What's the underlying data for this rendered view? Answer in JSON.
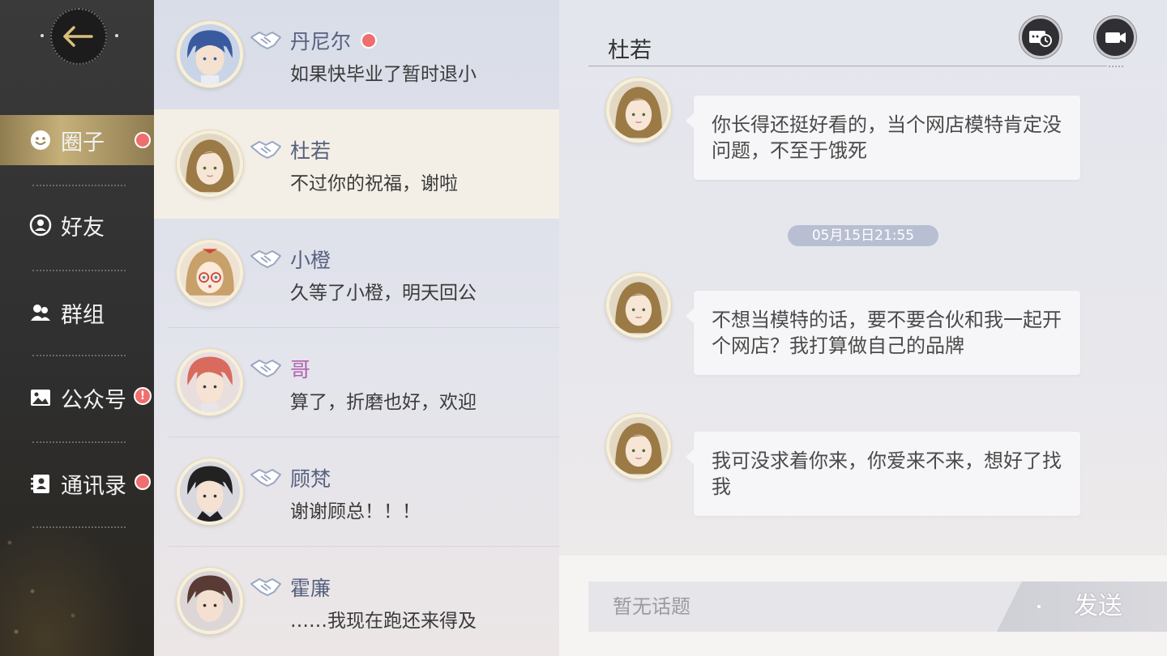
{
  "sidebar": {
    "back_icon": "back-arrow-icon",
    "items": [
      {
        "label": "圈子",
        "icon": "smiley-icon",
        "active": true,
        "badge": "dot"
      },
      {
        "label": "好友",
        "icon": "friend-icon",
        "active": false,
        "badge": null
      },
      {
        "label": "群组",
        "icon": "group-icon",
        "active": false,
        "badge": null
      },
      {
        "label": "公众号",
        "icon": "picture-icon",
        "active": false,
        "badge": "!"
      },
      {
        "label": "通讯录",
        "icon": "contacts-icon",
        "active": false,
        "badge": "dot"
      }
    ]
  },
  "conversations": [
    {
      "name": "丹尼尔",
      "preview": "如果快毕业了暂时退小",
      "unread": true,
      "selected": false
    },
    {
      "name": "杜若",
      "preview": "不过你的祝福，谢啦",
      "unread": false,
      "selected": true
    },
    {
      "name": "小橙",
      "preview": "久等了小橙，明天回公",
      "unread": false,
      "selected": false
    },
    {
      "name": "哥",
      "preview": "算了，折磨也好，欢迎",
      "unread": false,
      "selected": false
    },
    {
      "name": "顾梵",
      "preview": "谢谢顾总！！！",
      "unread": false,
      "selected": false
    },
    {
      "name": "霍廉",
      "preview": "……我现在跑还来得及",
      "unread": false,
      "selected": false
    }
  ],
  "chat": {
    "title": "杜若",
    "header_icons": [
      "history-icon",
      "video-icon"
    ],
    "messages": [
      {
        "text": "你长得还挺好看的，当个网店模特肯定没问题，不至于饿死"
      },
      {
        "text": "不想当模特的话，要不要合伙和我一起开个网店？我打算做自己的品牌"
      },
      {
        "text": "我可没求着你来，你爱来不来，想好了找我"
      }
    ],
    "timestamp": "05月15日21:55",
    "input_placeholder": "暂无话题",
    "send_label": "发送"
  },
  "colors": {
    "accent_gold": "#c6b07a",
    "badge_red": "#f06e6e",
    "name_blue": "#56607f",
    "name_pink": "#b162ac",
    "timestamp_bg": "#b9bfd2"
  }
}
